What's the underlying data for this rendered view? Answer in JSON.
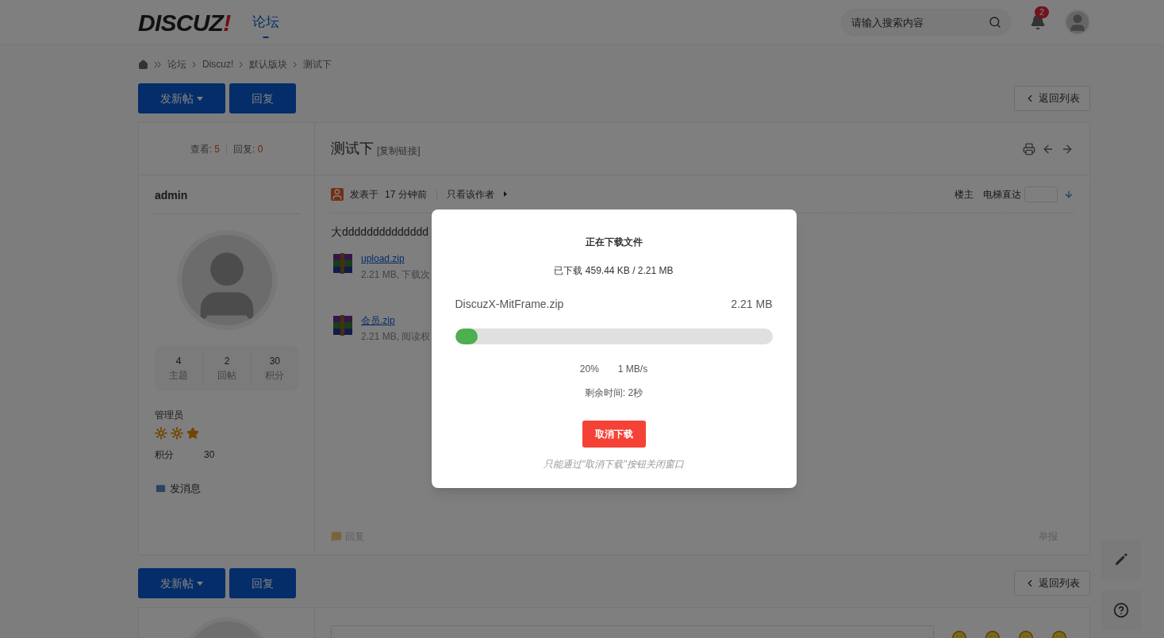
{
  "header": {
    "logo": {
      "text": "DISCUZ",
      "mark": "!"
    },
    "nav": [
      {
        "label": "论坛",
        "selected": true
      }
    ],
    "search": {
      "placeholder": "请输入搜索内容"
    },
    "notifications": "2"
  },
  "breadcrumb": [
    "论坛",
    "Discuz!",
    "默认版块",
    "测试下"
  ],
  "actions": {
    "new_post": "发新帖",
    "reply": "回复",
    "back": "返回列表"
  },
  "actions_bottom": {
    "new_post": "发新帖",
    "reply": "回复",
    "back": "返回列表"
  },
  "thread": {
    "views_label": "查看:",
    "views": "5",
    "replies_label": "回复:",
    "replies": "0",
    "title": "测试下",
    "copy_link": "[复制链接]"
  },
  "author": {
    "name": "admin",
    "stats": [
      {
        "value": "4",
        "label": "主题"
      },
      {
        "value": "2",
        "label": "回帖"
      },
      {
        "value": "30",
        "label": "积分"
      }
    ],
    "group": "管理员",
    "points_label": "积分",
    "points": "30",
    "message": "发消息"
  },
  "post": {
    "posted_label": "发表于",
    "time": "17 分钟前",
    "author_only": "只看该作者",
    "floor": "楼主",
    "jump_label": "电梯直达",
    "content": "大dddddddddddddd",
    "attachments": [
      {
        "name": "upload.zip",
        "info": "2.21 MB, 下载次"
      },
      {
        "name": "会员.zip",
        "info": "2.21 MB, 阅读权"
      }
    ],
    "reply": "回复",
    "report": "举报"
  },
  "download": {
    "title": "正在下载文件",
    "progress_text": "已下载 459.44 KB / 2.21 MB",
    "file_name": "DiscuzX-MitFrame.zip",
    "file_size": "2.21 MB",
    "level": 0.07,
    "percent": "20%",
    "speed": "1 MB/s",
    "remaining": "剩余时间: 2秒",
    "cancel": "取消下载",
    "note": "只能通过\"取消下载\"按钮关闭窗口"
  }
}
